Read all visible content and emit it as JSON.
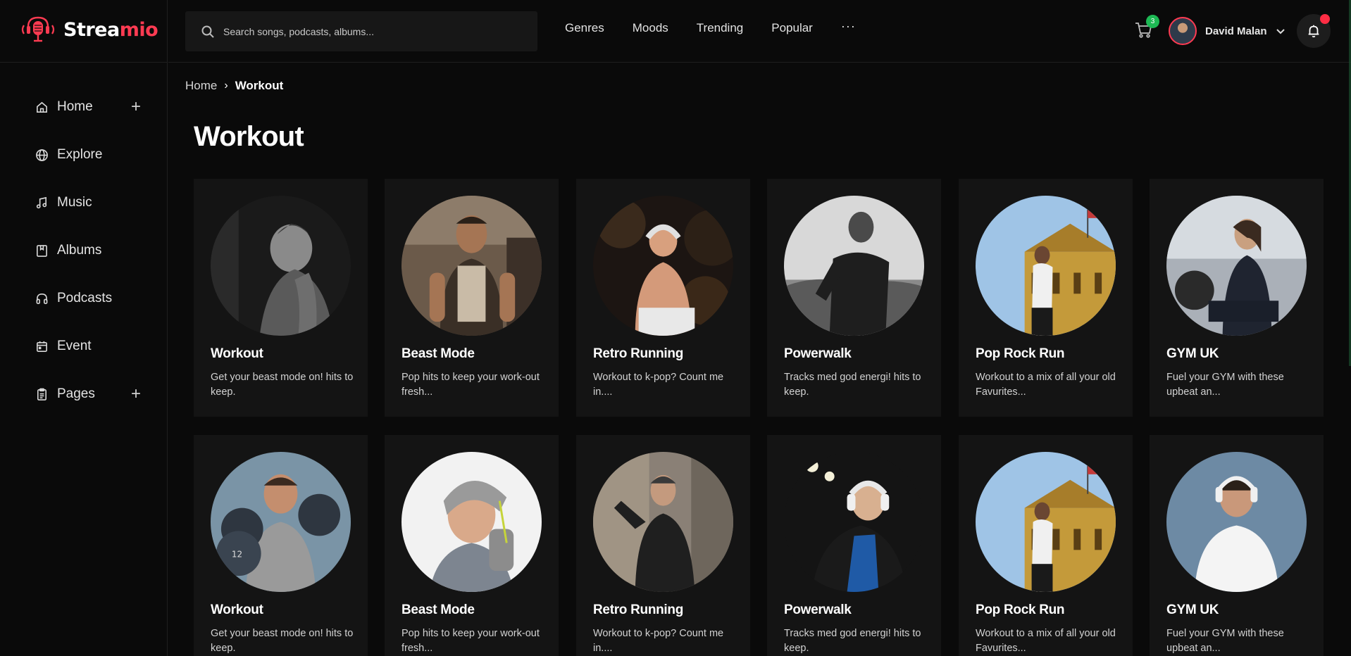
{
  "brand": {
    "name_part1": "Strea",
    "name_part2": "mio",
    "accent": "#ff3b52"
  },
  "sidebar": {
    "items": [
      {
        "label": "Home",
        "icon": "home-icon",
        "has_plus": true
      },
      {
        "label": "Explore",
        "icon": "globe-icon",
        "has_plus": false
      },
      {
        "label": "Music",
        "icon": "music-note-icon",
        "has_plus": false
      },
      {
        "label": "Albums",
        "icon": "album-icon",
        "has_plus": false
      },
      {
        "label": "Podcasts",
        "icon": "headphones-icon",
        "has_plus": false
      },
      {
        "label": "Event",
        "icon": "calendar-icon",
        "has_plus": false
      },
      {
        "label": "Pages",
        "icon": "clipboard-icon",
        "has_plus": true
      }
    ]
  },
  "header": {
    "search_placeholder": "Search songs, podcasts, albums...",
    "nav": [
      "Genres",
      "Moods",
      "Trending",
      "Popular"
    ],
    "more_label": "···",
    "cart_count": "3",
    "user_name": "David Malan"
  },
  "breadcrumb": {
    "home": "Home",
    "current": "Workout"
  },
  "page": {
    "title": "Workout"
  },
  "cards": [
    {
      "title": "Workout",
      "desc": "Get your beast mode on! hits to keep.",
      "art": "bw-woman"
    },
    {
      "title": "Beast Mode",
      "desc": "Pop hits to keep your work-out fresh...",
      "art": "gym-man"
    },
    {
      "title": "Retro Running",
      "desc": "Workout to k-pop? Count me in....",
      "art": "runner-warm"
    },
    {
      "title": "Powerwalk",
      "desc": "Tracks med god energi! hits to keep.",
      "art": "bw-runner"
    },
    {
      "title": "Pop Rock Run",
      "desc": "Workout to a mix of all your old Favurites...",
      "art": "palace-run"
    },
    {
      "title": "GYM UK",
      "desc": "Fuel your GYM with these upbeat an...",
      "art": "gym-woman"
    },
    {
      "title": "Workout",
      "desc": "Get your beast mode on! hits to keep.",
      "art": "dumbbells"
    },
    {
      "title": "Beast Mode",
      "desc": "Pop hits to keep your work-out fresh...",
      "art": "beanie-man"
    },
    {
      "title": "Retro Running",
      "desc": "Workout to k-pop? Count me in....",
      "art": "stretch-man"
    },
    {
      "title": "Powerwalk",
      "desc": "Tracks med god energi! hits to keep.",
      "art": "headphones-night"
    },
    {
      "title": "Pop Rock Run",
      "desc": "Workout to a mix of all your old Favurites...",
      "art": "palace-run"
    },
    {
      "title": "GYM UK",
      "desc": "Fuel your GYM with these upbeat an...",
      "art": "white-tee-man"
    }
  ]
}
